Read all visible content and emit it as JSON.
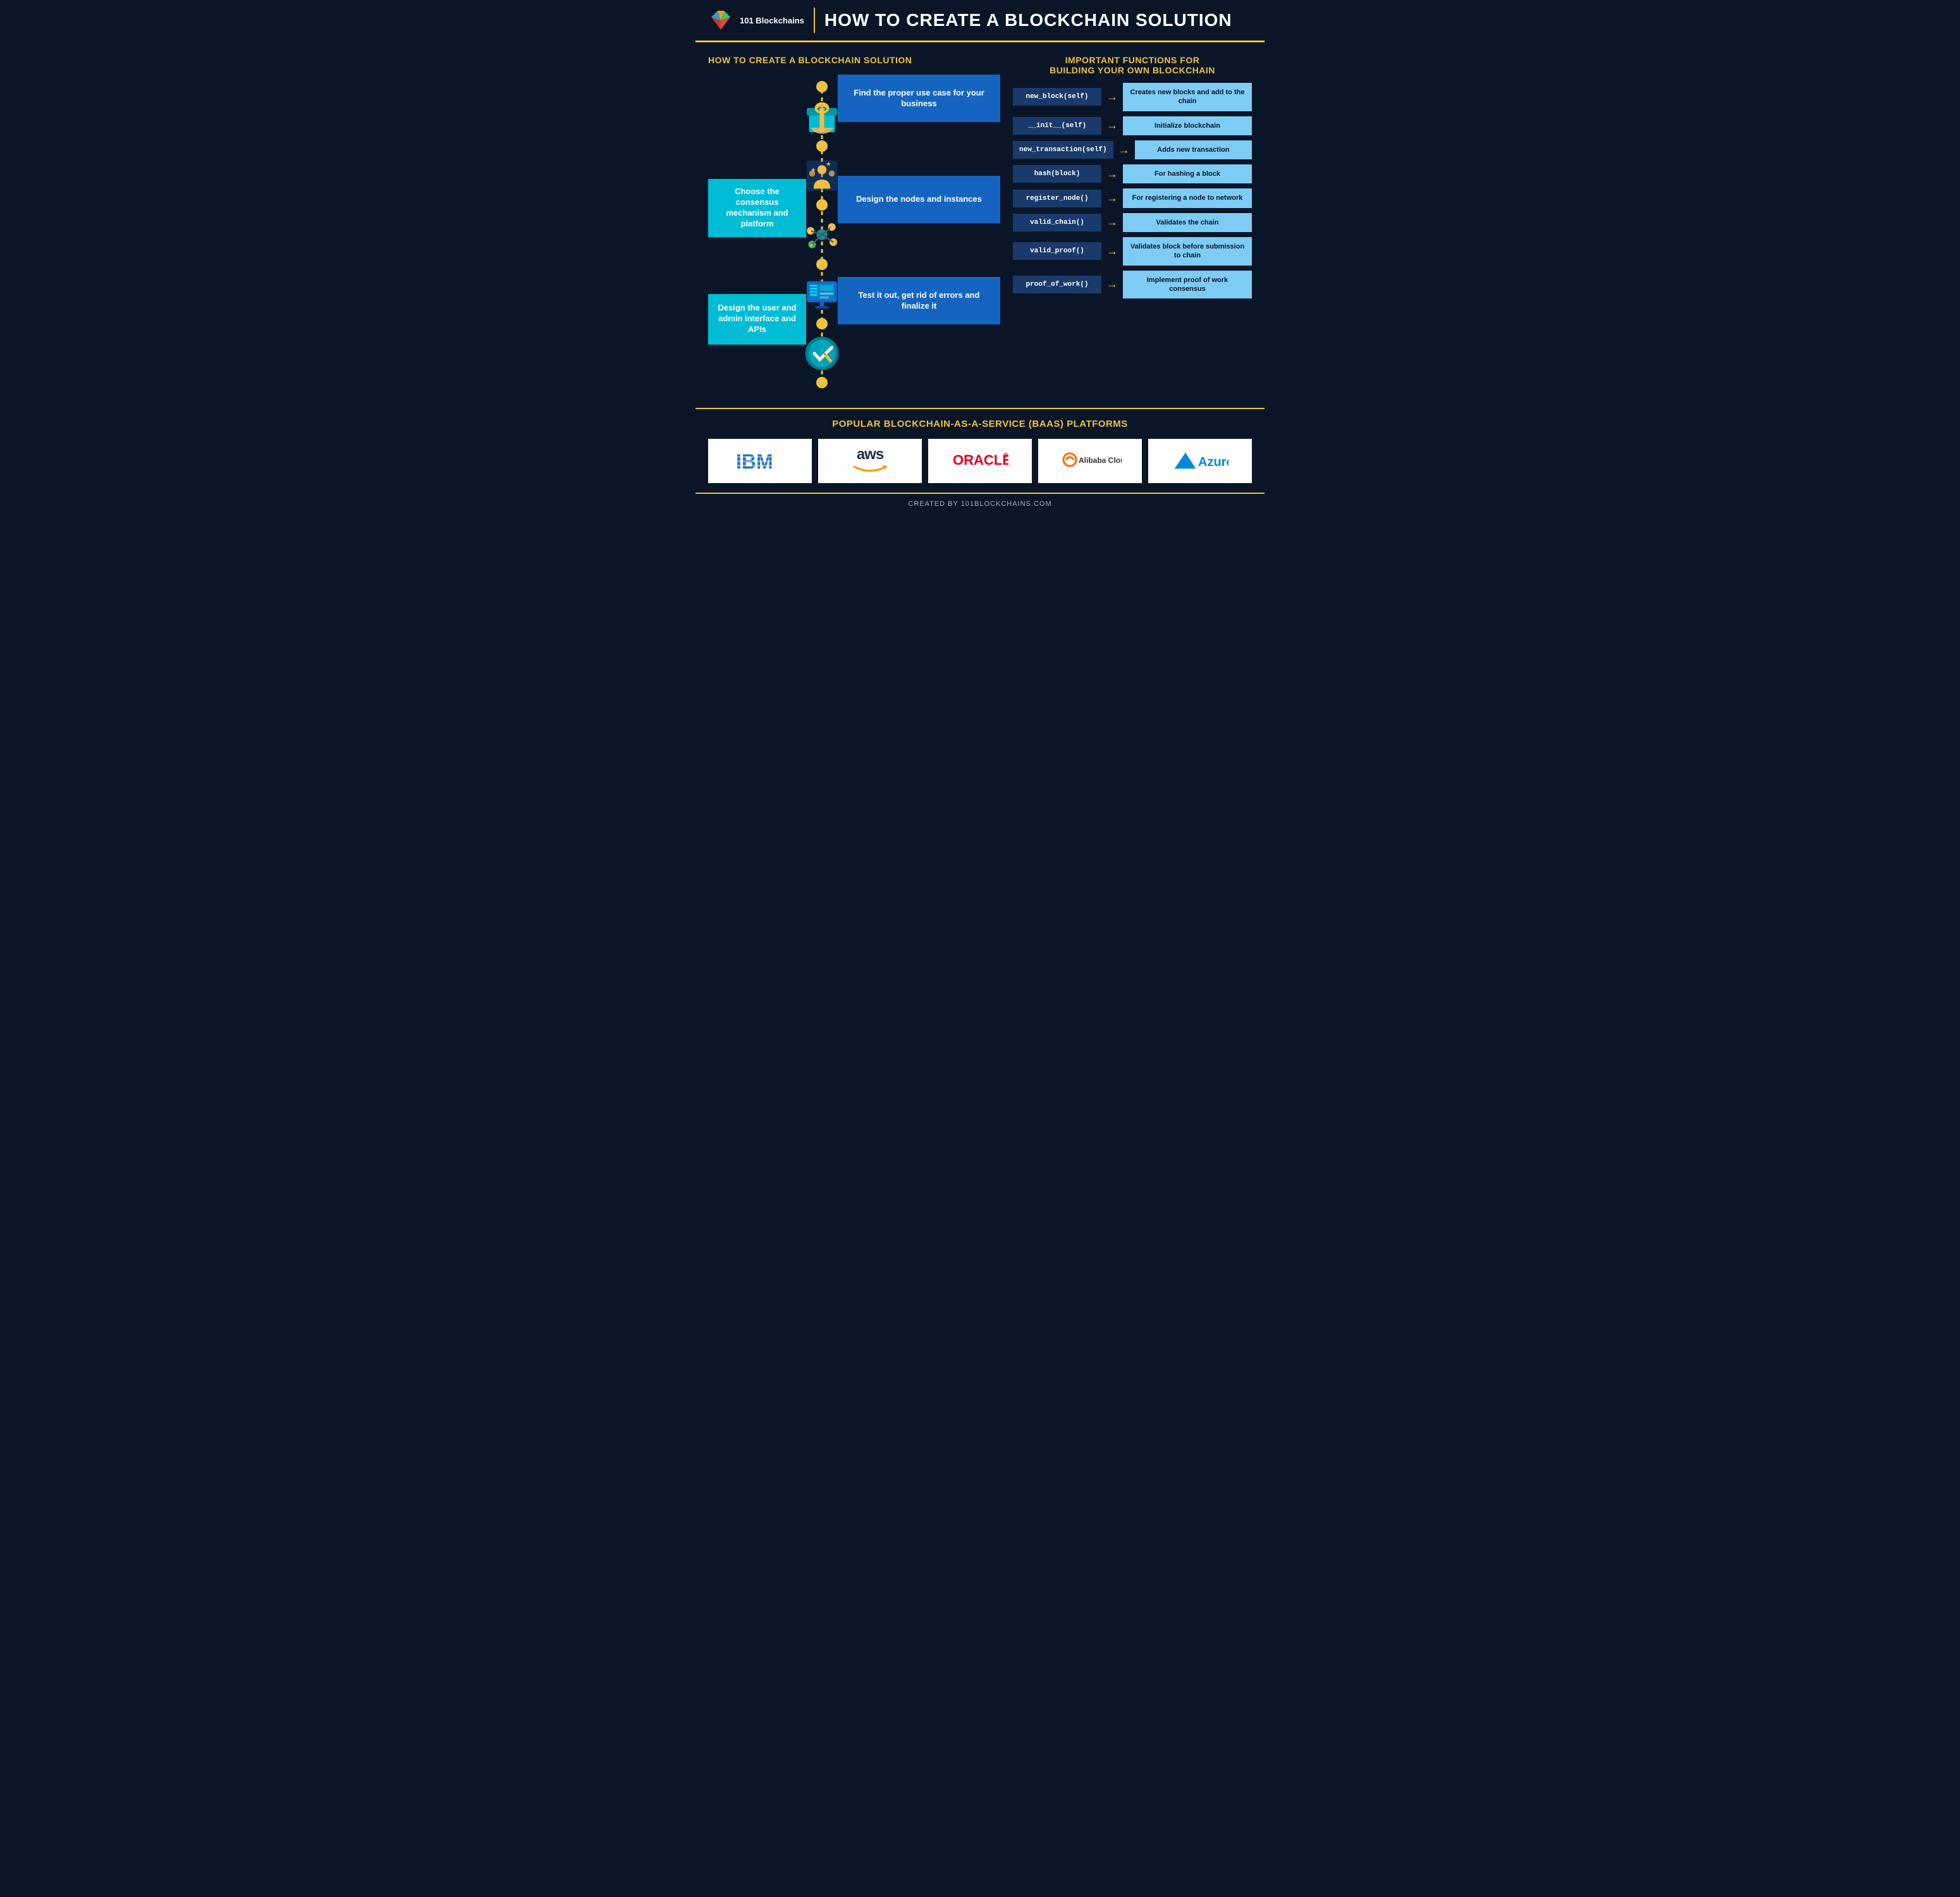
{
  "header": {
    "logo_text": "101 Blockchains",
    "main_title": "HOW TO CREATE A BLOCKCHAIN SOLUTION"
  },
  "left_section": {
    "title": "HOW TO CREATE A BLOCKCHAIN SOLUTION",
    "left_boxes": [
      {
        "text": "Choose the consensus mechanism and platform"
      },
      {
        "text": "Design the user and admin interface and APIs"
      }
    ],
    "right_boxes": [
      {
        "text": "Find the proper use case for your business"
      },
      {
        "text": "Design the nodes and instances"
      },
      {
        "text": "Test it out, get rid of errors and finalize it"
      }
    ]
  },
  "right_section": {
    "title_line1": "IMPORTANT  FUNCTIONS FOR",
    "title_line2": "BUILDING YOUR OWN BLOCKCHAIN",
    "functions": [
      {
        "name": "new_block(self)",
        "desc": "Creates new blocks and add to the chain"
      },
      {
        "name": "__init__(self)",
        "desc": "Initialize blockchain"
      },
      {
        "name": "new_transaction(self)",
        "desc": "Adds new transaction"
      },
      {
        "name": "hash(block)",
        "desc": "For hashing a block"
      },
      {
        "name": "register_node()",
        "desc": "For registering a node to network"
      },
      {
        "name": "valid_chain()",
        "desc": "Validates the chain"
      },
      {
        "name": "valid_proof()",
        "desc": "Validates block before submission to chain"
      },
      {
        "name": "proof_of_work()",
        "desc": "Implement proof of work consensus"
      }
    ]
  },
  "baas_section": {
    "title": "POPULAR BLOCKCHAIN-AS-A-SERVICE (BAAS) PLATFORMS",
    "platforms": [
      "IBM",
      "aws",
      "ORACLE",
      "Alibaba Cloud",
      "Azure"
    ]
  },
  "footer": {
    "text": "CREATED BY 101BLOCKCHAINS.COM"
  }
}
